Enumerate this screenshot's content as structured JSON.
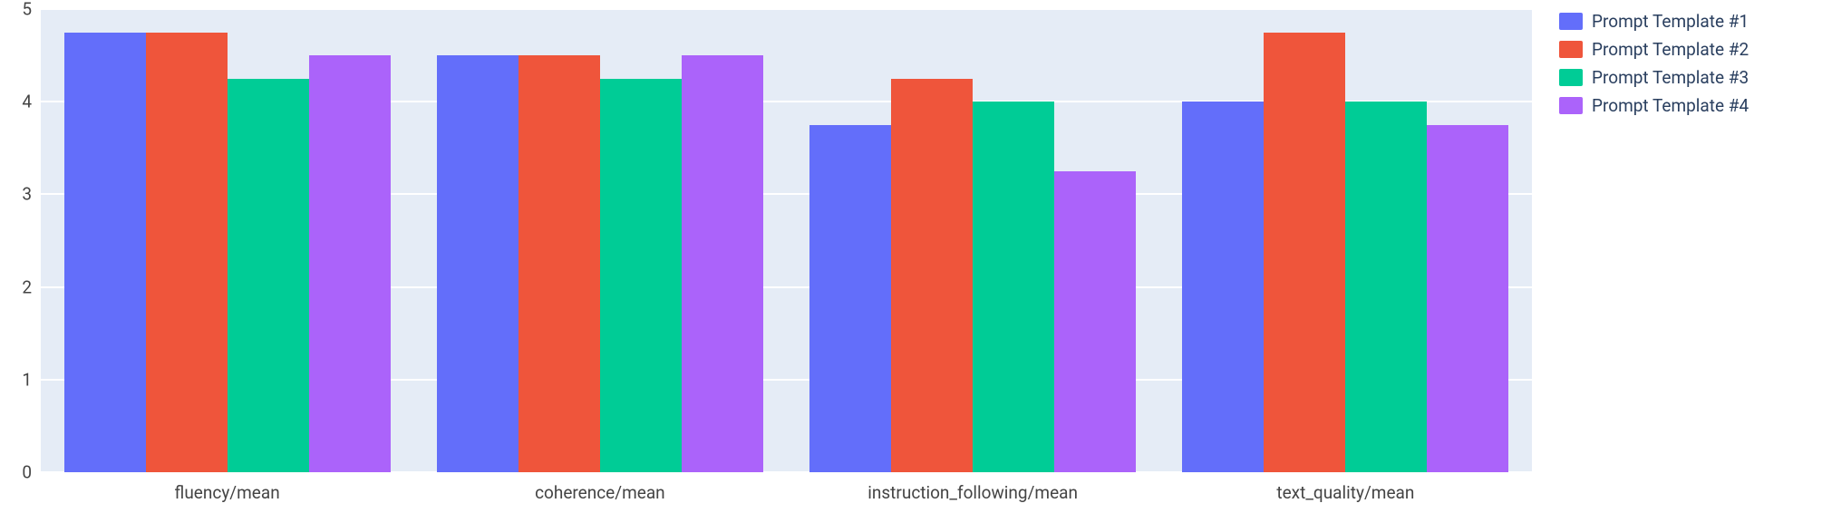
{
  "chart_data": {
    "type": "bar",
    "categories": [
      "fluency/mean",
      "coherence/mean",
      "instruction_following/mean",
      "text_quality/mean"
    ],
    "series": [
      {
        "name": "Prompt Template #1",
        "color": "#636efa",
        "values": [
          4.75,
          4.5,
          3.75,
          4.0
        ]
      },
      {
        "name": "Prompt Template #2",
        "color": "#ef553b",
        "values": [
          4.75,
          4.5,
          4.25,
          4.75
        ]
      },
      {
        "name": "Prompt Template #3",
        "color": "#00cc96",
        "values": [
          4.25,
          4.25,
          4.0,
          4.0
        ]
      },
      {
        "name": "Prompt Template #4",
        "color": "#ab63fa",
        "values": [
          4.5,
          4.5,
          3.25,
          3.75
        ]
      }
    ],
    "ylim": [
      0,
      5
    ],
    "yticks": [
      0,
      1,
      2,
      3,
      4,
      5
    ],
    "title": "",
    "xlabel": "",
    "ylabel": ""
  },
  "legend": {
    "items": [
      {
        "label": "Prompt Template #1"
      },
      {
        "label": "Prompt Template #2"
      },
      {
        "label": "Prompt Template #3"
      },
      {
        "label": "Prompt Template #4"
      }
    ]
  }
}
